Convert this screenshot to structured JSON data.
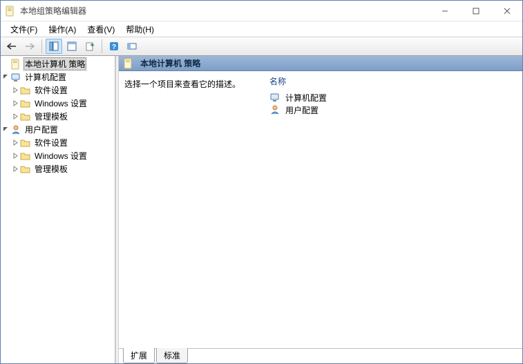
{
  "window_title": "本地组策略编辑器",
  "menu": {
    "file": "文件(F)",
    "action": "操作(A)",
    "view": "查看(V)",
    "help": "帮助(H)"
  },
  "tree": {
    "root": "本地计算机 策略",
    "computer": "计算机配置",
    "user": "用户配置",
    "software": "软件设置",
    "windows": "Windows 设置",
    "templates": "管理模板"
  },
  "pane": {
    "title": "本地计算机 策略",
    "desc_prompt": "选择一个项目来查看它的描述。",
    "col_name": "名称",
    "item_computer": "计算机配置",
    "item_user": "用户配置"
  },
  "tabs": {
    "extended": "扩展",
    "standard": "标准"
  }
}
